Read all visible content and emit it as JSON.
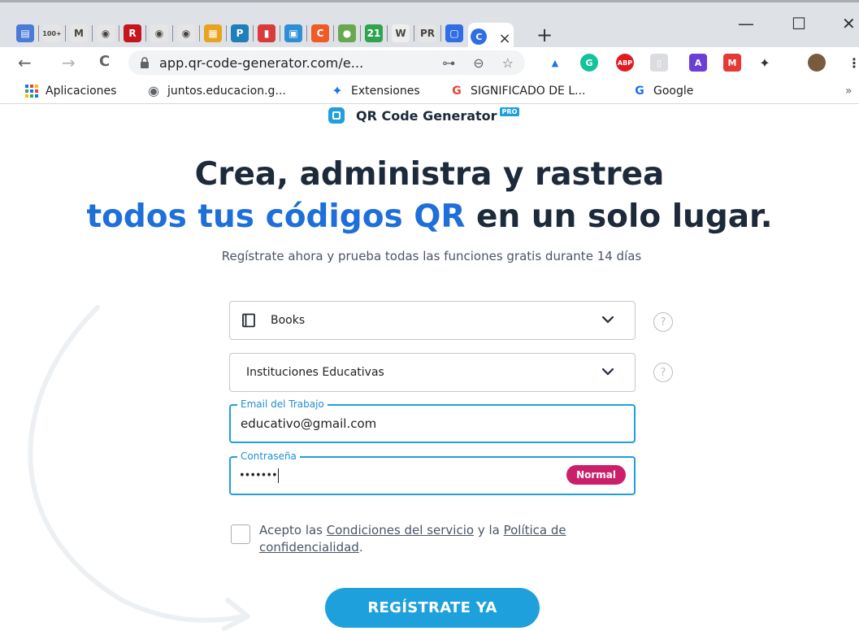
{
  "browser": {
    "tabs": [
      {
        "icon": "calendar-icon",
        "color": "#4a7bd6",
        "glyph": "▤"
      },
      {
        "icon": "gmail-counter-icon",
        "color": "#e5e5e5",
        "glyph": "100+"
      },
      {
        "icon": "gmail-icon",
        "color": "#e5e5e5",
        "glyph": "M"
      },
      {
        "icon": "globe-icon",
        "color": "#e5e5e5",
        "glyph": "◉"
      },
      {
        "icon": "red-r-icon",
        "color": "#c4161c",
        "glyph": "R"
      },
      {
        "icon": "globe-icon",
        "color": "#e5e5e5",
        "glyph": "◉"
      },
      {
        "icon": "globe-icon",
        "color": "#e5e5e5",
        "glyph": "◉"
      },
      {
        "icon": "puzzle-app-icon",
        "color": "#e9a321",
        "glyph": "▦"
      },
      {
        "icon": "pinterest-icon",
        "color": "#1f7fb8",
        "glyph": "P"
      },
      {
        "icon": "book-icon",
        "color": "#d93b3b",
        "glyph": "▮"
      },
      {
        "icon": "tool-icon",
        "color": "#2d8fd5",
        "glyph": "▣"
      },
      {
        "icon": "orange-c-icon",
        "color": "#ef5a25",
        "glyph": "C"
      },
      {
        "icon": "colorful-circle-icon",
        "color": "#6aa84f",
        "glyph": "●"
      },
      {
        "icon": "green-21-icon",
        "color": "#2ea44f",
        "glyph": "21"
      },
      {
        "icon": "wikipedia-icon",
        "color": "#eeeeee",
        "glyph": "W"
      },
      {
        "icon": "pr-icon",
        "color": "#e5e5e5",
        "glyph": "PR"
      },
      {
        "icon": "blue-square-icon",
        "color": "#2f6ee5",
        "glyph": "▢"
      }
    ],
    "active_tab": {
      "icon": "qr-generator-icon",
      "glyph": "C",
      "close": "×"
    },
    "new_tab": "+",
    "window": {
      "minimize": "—",
      "maximize": "☐",
      "close": "✕"
    },
    "nav": {
      "back": "←",
      "forward": "→",
      "reload": "C"
    },
    "url": "app.qr-code-generator.com/e...",
    "omni_icons": [
      "key-icon",
      "zoom-icon",
      "star-icon"
    ],
    "extensions": [
      {
        "icon": "blue-cap-icon",
        "color": "#1a73e8",
        "glyph": "▲"
      },
      {
        "icon": "grammarly-icon",
        "color": "#15c39a",
        "glyph": "G"
      },
      {
        "icon": "adblock-icon",
        "color": "#e21b23",
        "glyph": "ABP"
      },
      {
        "icon": "document-icon",
        "color": "#dadce0",
        "glyph": "▯"
      },
      {
        "icon": "purple-a-icon",
        "color": "#6b3fd4",
        "glyph": "A"
      },
      {
        "icon": "red-m-icon",
        "color": "#e53935",
        "glyph": "M"
      },
      {
        "icon": "puzzle-icon",
        "color": "#ffffff",
        "glyph": "✦"
      },
      {
        "icon": "profile-avatar-icon",
        "color": "#7a5a3c",
        "glyph": "●"
      },
      {
        "icon": "menu-dots-icon",
        "color": "#ffffff",
        "glyph": "⋮"
      }
    ],
    "bookmarks": [
      {
        "icon": "apps-grid-icon",
        "label": "Aplicaciones"
      },
      {
        "icon": "globe-icon",
        "label": "juntos.educacion.g..."
      },
      {
        "icon": "puzzle-icon",
        "label": "Extensiones"
      },
      {
        "icon": "google-icon",
        "label": "SIGNIFICADO DE L..."
      },
      {
        "icon": "google-icon",
        "label": "Google"
      }
    ],
    "bookmarks_overflow": "»"
  },
  "brand": {
    "name": "QR Code Generator",
    "badge": "PRO"
  },
  "headline": {
    "line1": "Crea, administra y rastrea",
    "line2_blue": "todos tus códigos QR",
    "line2_rest": " en un solo lugar."
  },
  "subtitle": "Regístrate ahora y prueba todas las funciones gratis durante 14 días",
  "form": {
    "category": {
      "value": "Books",
      "icon": "book-icon"
    },
    "organization": {
      "value": "Instituciones Educativas"
    },
    "email": {
      "label": "Email del Trabajo",
      "value": "educativo@gmail.com"
    },
    "password": {
      "label": "Contraseña",
      "value": "•••••••",
      "strength": "Normal"
    },
    "help": "?",
    "terms": {
      "prefix": "Acepto las ",
      "link1": "Condiciones del servicio",
      "middle": " y la ",
      "link2": "Política de confidencialidad",
      "suffix": "."
    },
    "submit": "REGÍSTRATE YA"
  },
  "colors": {
    "accent": "#1ea0dc",
    "heading": "#1d2a3a",
    "heading_blue": "#1e6fd9",
    "strength_badge": "#cc1f6a"
  }
}
